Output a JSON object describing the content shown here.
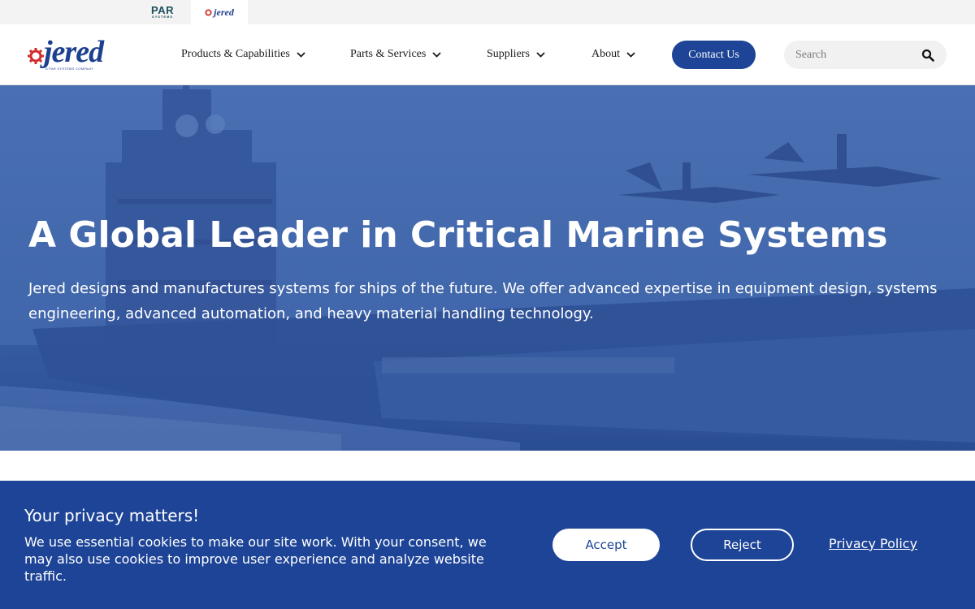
{
  "brand_switcher": {
    "par_logo_text": "PAR",
    "par_logo_subtext": "SYSTEMS",
    "jered_logo_text": "jered"
  },
  "header": {
    "logo_text": "jered",
    "logo_tagline": "A PAR SYSTEMS COMPANY",
    "nav": [
      {
        "label": "Products & Capabilities",
        "icon": "chevron-down-icon"
      },
      {
        "label": "Parts & Services",
        "icon": "chevron-down-icon"
      },
      {
        "label": "Suppliers",
        "icon": "chevron-down-icon"
      },
      {
        "label": "About",
        "icon": "chevron-down-icon"
      }
    ],
    "contact_label": "Contact Us",
    "search": {
      "placeholder": "Search",
      "value": "",
      "icon": "search-icon"
    }
  },
  "hero": {
    "title": "A Global Leader in Critical Marine Systems",
    "text": "Jered designs and manufactures systems for ships of the future. We offer advanced expertise in equipment design, systems engineering, advanced automation, and heavy material handling technology."
  },
  "cookie_banner": {
    "title": "Your privacy matters!",
    "text": "We use essential cookies to make our site work. With your consent, we may also use cookies to improve user experience and analyze website traffic.",
    "accept_label": "Accept",
    "reject_label": "Reject",
    "privacy_label": "Privacy Policy"
  },
  "colors": {
    "brand_blue": "#1d4496",
    "hero_overlay": "#2e55a0",
    "gear_red": "#d12f2f"
  }
}
